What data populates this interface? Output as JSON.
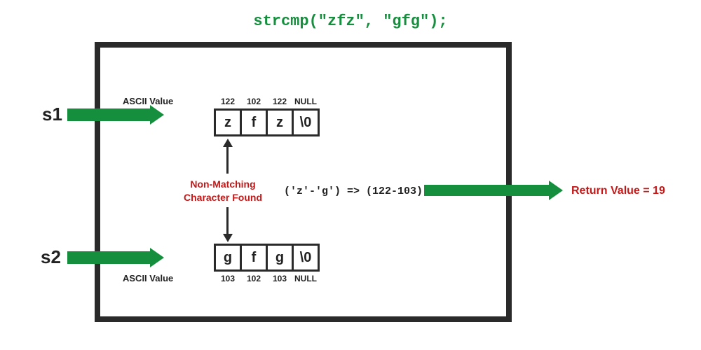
{
  "title": "strcmp(\"zfz\", \"gfg\");",
  "labels": {
    "s1": "s1",
    "s2": "s2",
    "ascii": "ASCII Value",
    "nonmatch_l1": "Non-Matching",
    "nonmatch_l2": "Character Found",
    "calc": "('z'-'g') => (122-103)",
    "return": "Return Value = 19"
  },
  "rows": {
    "s1": {
      "chars": [
        "z",
        "f",
        "z",
        "\\0"
      ],
      "ascii": [
        "122",
        "102",
        "122",
        "NULL"
      ]
    },
    "s2": {
      "chars": [
        "g",
        "f",
        "g",
        "\\0"
      ],
      "ascii": [
        "103",
        "102",
        "103",
        "NULL"
      ]
    }
  },
  "chart_data": {
    "type": "table",
    "function": "strcmp",
    "args": [
      "zfz",
      "gfg"
    ],
    "strings": [
      {
        "name": "s1",
        "chars": [
          "z",
          "f",
          "z",
          "\\0"
        ],
        "ascii": [
          122,
          102,
          122,
          null
        ]
      },
      {
        "name": "s2",
        "chars": [
          "g",
          "f",
          "g",
          "\\0"
        ],
        "ascii": [
          103,
          102,
          103,
          null
        ]
      }
    ],
    "first_mismatch_index": 0,
    "computation": "('z'-'g') => (122-103)",
    "return_value": 19
  }
}
